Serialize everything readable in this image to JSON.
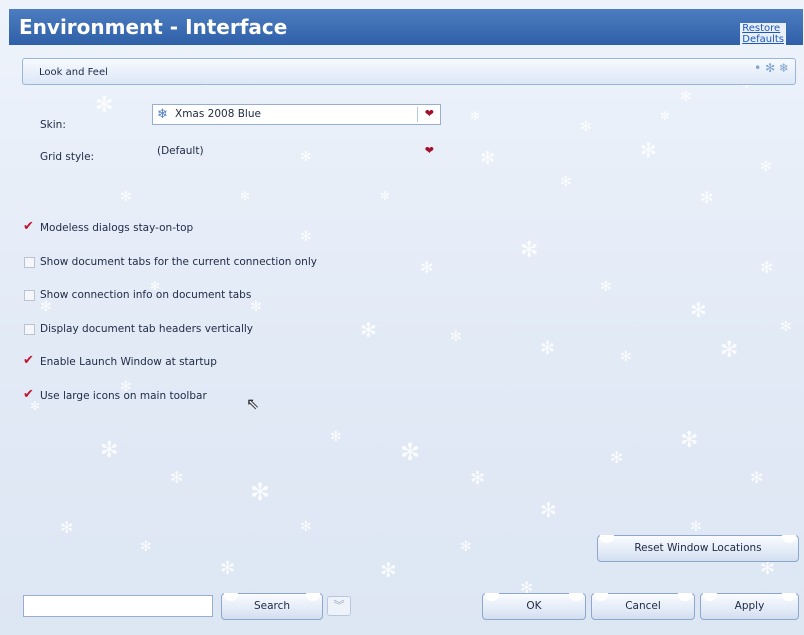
{
  "window": {
    "title": "Environment - Interface",
    "restore_defaults": "Restore Defaults"
  },
  "section": {
    "title": "Look and Feel"
  },
  "skin": {
    "label": "Skin:",
    "value": "Xmas 2008 Blue"
  },
  "grid_style": {
    "label": "Grid style:",
    "value": "(Default)"
  },
  "options": [
    {
      "label": "Modeless dialogs stay-on-top",
      "checked": true
    },
    {
      "label": "Show document tabs for the current connection only",
      "checked": false
    },
    {
      "label": "Show connection info on document tabs",
      "checked": false
    },
    {
      "label": "Display document tab headers vertically",
      "checked": false
    },
    {
      "label": "Enable Launch Window at startup",
      "checked": true
    },
    {
      "label": "Use large icons on main toolbar",
      "checked": true
    }
  ],
  "buttons": {
    "reset_window_locations": "Reset Window Locations",
    "search": "Search",
    "ok": "OK",
    "cancel": "Cancel",
    "apply": "Apply"
  },
  "search": {
    "value": ""
  },
  "icons": {
    "skin": "snowflake-icon",
    "dropdown": "heart-chevron-icon",
    "check": "checkmark-icon",
    "helper": "chevron-double-down-icon"
  },
  "colors": {
    "header": "#3a69b0",
    "header_text": "#ffffff",
    "check": "#c0152f",
    "background": "#e3ecf8"
  }
}
